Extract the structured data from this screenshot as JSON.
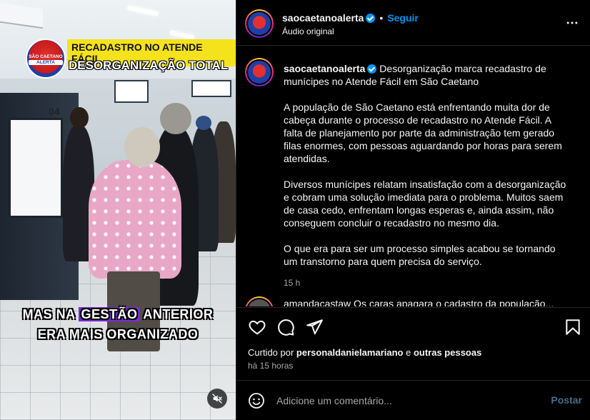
{
  "video": {
    "logo_lines": [
      "SÃO CAETANO",
      "ALERTA"
    ],
    "banner_top": "RECADASTRO NO ATENDE FÁCIL",
    "banner_bottom": "DESORGANIZAÇÃO TOTAL",
    "counter_number": "04",
    "caption_line1_before": "MAS NA ",
    "caption_line1_highlight": "GESTÃO",
    "caption_line1_after": " ANTERIOR",
    "caption_line2": "ERA MAIS ORGANIZADO",
    "mute_icon": "speaker-muted-icon"
  },
  "header": {
    "username": "saocaetanoalerta",
    "separator": "•",
    "follow_label": "Seguir",
    "audio_label": "Áudio original"
  },
  "post": {
    "username": "saocaetanoalerta",
    "headline": "Desorganização marca recadastro de munícipes no Atende Fácil em São Caetano",
    "paragraphs": [
      "A população de São Caetano está enfrentando muita dor de cabeça durante o processo de recadastro no Atende Fácil. A falta de planejamento por parte da administração tem gerado filas enormes, com pessoas aguardando por horas para serem atendidas.",
      "Diversos munícipes relatam insatisfação com a desorganização e cobram uma solução imediata para o problema. Muitos saem de casa cedo, enfrentam longas esperas e, ainda assim, não conseguem concluir o recadastro no mesmo dia.",
      "O que era para ser um processo simples acabou se tornando um transtorno para quem precisa do serviço."
    ],
    "time_ago": "15 h",
    "next_comment_partial": "amandacastaw Os caras apagara o cadastro da população..."
  },
  "actions": {
    "icons": [
      "heart-icon",
      "comment-icon",
      "share-icon",
      "bookmark-icon"
    ]
  },
  "likes": {
    "prefix": "Curtido por ",
    "user": "personaldanielamariano",
    "joiner": " e ",
    "others": "outras pessoas"
  },
  "posted_when": "há 15 horas",
  "composer": {
    "placeholder": "Adicione um comentário...",
    "post_label": "Postar"
  },
  "colors": {
    "accent": "#0095f6",
    "banner_yellow": "#f4e21c",
    "caption_highlight": "#7a2bd6"
  }
}
